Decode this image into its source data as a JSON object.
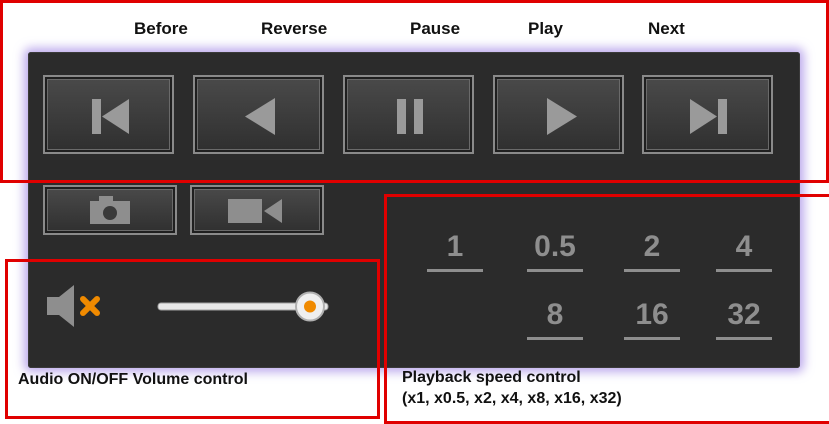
{
  "controls": {
    "before_label": "Before",
    "reverse_label": "Reverse",
    "pause_label": "Pause",
    "play_label": "Play",
    "next_label": "Next"
  },
  "speed": {
    "options": [
      "1",
      "0.5",
      "2",
      "4",
      "8",
      "16",
      "32"
    ]
  },
  "captions": {
    "audio": "Audio ON/OFF Volume control",
    "speed_line1": "Playback speed control",
    "speed_line2": "(x1, x0.5, x2, x4, x8, x16, x32)"
  },
  "audio": {
    "muted": true,
    "volume": 0.82
  },
  "colors": {
    "highlight_box": "#e00000",
    "mute_x": "#f08a00",
    "panel_glow": "#a58ce6"
  },
  "icons": [
    "before-icon",
    "reverse-icon",
    "pause-icon",
    "play-icon",
    "next-icon",
    "camera-icon",
    "video-record-icon",
    "speaker-icon",
    "mute-x-icon"
  ]
}
